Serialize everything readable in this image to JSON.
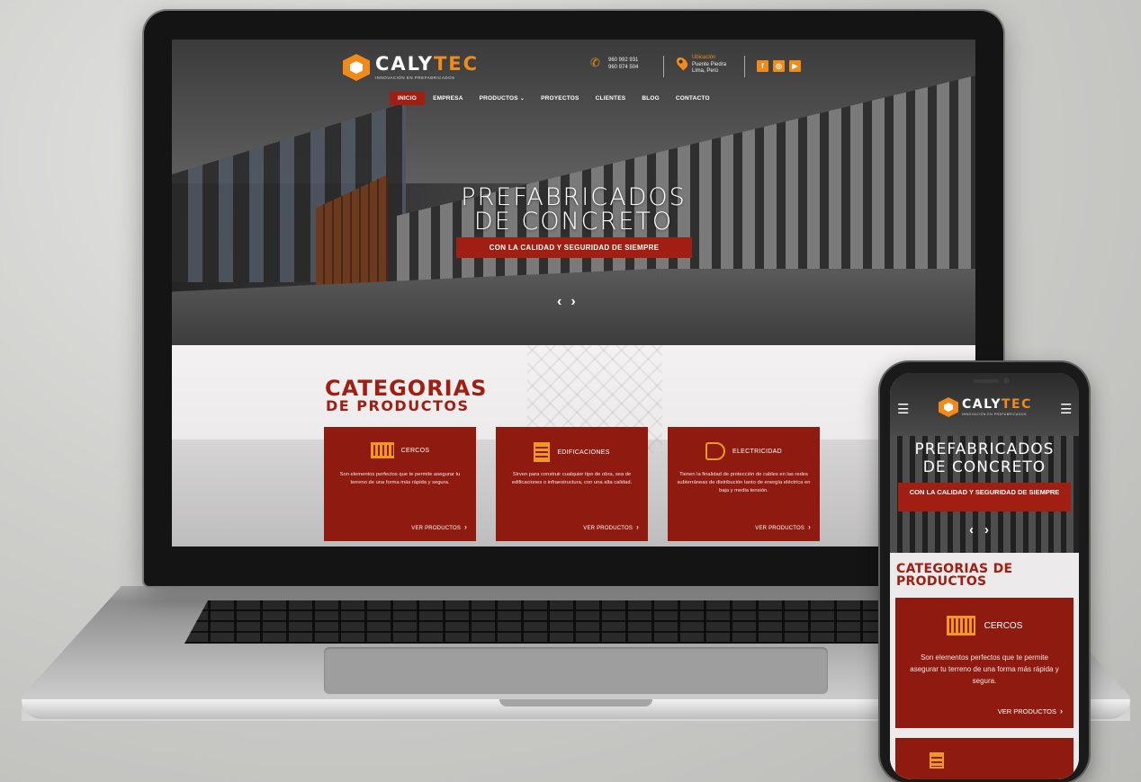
{
  "brand": {
    "name_part1": "CALY",
    "name_part2": "TEC",
    "tagline": "INNOVACIÓN EN PREFABRICADOS",
    "accent_color": "#ef8a1b",
    "primary_color": "#a01e12"
  },
  "header": {
    "phones": [
      "960 992 931",
      "960 974 504"
    ],
    "location": {
      "label": "Ubicación",
      "line1": "Puente Piedra",
      "line2": "Lima, Perú"
    },
    "socials": [
      {
        "icon": "facebook-icon",
        "glyph": "f"
      },
      {
        "icon": "instagram-icon",
        "glyph": "◎"
      },
      {
        "icon": "youtube-icon",
        "glyph": "▶"
      }
    ]
  },
  "nav": {
    "items": [
      {
        "label": "INICIO",
        "active": true
      },
      {
        "label": "EMPRESA"
      },
      {
        "label": "PRODUCTOS",
        "has_dropdown": true
      },
      {
        "label": "PROYECTOS"
      },
      {
        "label": "CLIENTES"
      },
      {
        "label": "BLOG"
      },
      {
        "label": "CONTACTO"
      }
    ]
  },
  "hero": {
    "title_line1": "PREFABRICADOS",
    "title_line2": "DE CONCRETO",
    "cta": "CON LA CALIDAD Y SEGURIDAD DE SIEMPRE",
    "prev": "‹",
    "next": "›"
  },
  "categories": {
    "title": "CATEGORIAS",
    "subtitle": "DE PRODUCTOS",
    "cards": [
      {
        "name": "CERCOS",
        "icon": "fence-icon",
        "description": "Son elementos perfectos que te permite asegurar tu terreno de una forma más rápida y segura.",
        "link": "VER PRODUCTOS"
      },
      {
        "name": "EDIFICACIONES",
        "icon": "building-icon",
        "description": "Sirven para construir cualquier tipo de obra, sea de edificaciones o infraestructura, con una alta calidad.",
        "link": "VER PRODUCTOS"
      },
      {
        "name": "ELECTRICIDAD",
        "icon": "plug-icon",
        "description": "Tienen la finalidad de protección de cables en las redes subterráneas de distribución tanto de energía eléctrica en baja y media tensión.",
        "link": "VER PRODUCTOS"
      }
    ]
  },
  "mobile": {
    "menu_glyph": "☰",
    "title_line1": "PREFABRICADOS",
    "title_line2": "DE CONCRETO",
    "cta": "CON LA CALIDAD Y SEGURIDAD DE SIEMPRE",
    "categories_title": "CATEGORIAS DE PRODUCTOS",
    "card": {
      "name": "CERCOS",
      "description": "Son elementos perfectos que te permite asegurar tu terreno de una forma más rápida y segura.",
      "link": "VER PRODUCTOS"
    }
  },
  "chevron": "›"
}
